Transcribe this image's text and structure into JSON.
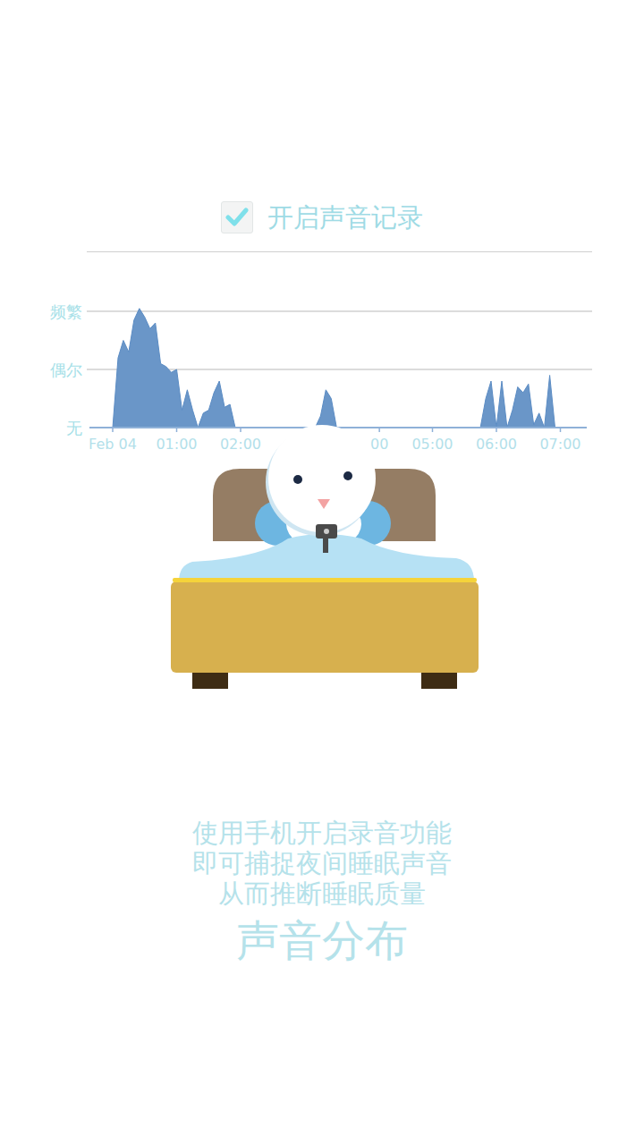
{
  "checkbox": {
    "label": "开启声音记录",
    "checked": true
  },
  "chart": {
    "y_ticks": [
      {
        "label": "频繁",
        "value": 2
      },
      {
        "label": "偶尔",
        "value": 1
      },
      {
        "label": "无",
        "value": 0
      }
    ],
    "x_ticks": [
      {
        "label": "Feb 04",
        "hour": 0
      },
      {
        "label": "01:00",
        "hour": 1
      },
      {
        "label": "02:00",
        "hour": 2
      },
      {
        "label": "00",
        "hour": 4.17
      },
      {
        "label": "05:00",
        "hour": 5
      },
      {
        "label": "06:00",
        "hour": 6
      },
      {
        "label": "07:00",
        "hour": 7
      }
    ],
    "series": [
      {
        "values": [
          0,
          1.2,
          1.5,
          1.3,
          1.85,
          2.05,
          1.9,
          1.7,
          1.8,
          1.1,
          1.05,
          0.95,
          1.0,
          0.3,
          0.65,
          0.3,
          0,
          0.25,
          0.3,
          0.6,
          0.8,
          0.35,
          0.4,
          0,
          0,
          0,
          0,
          0,
          0,
          0,
          0,
          0,
          0,
          0,
          0,
          0,
          0,
          0,
          0,
          0.2,
          0.65,
          0.5,
          0,
          0,
          0,
          0,
          0,
          0,
          0,
          0,
          0,
          0,
          0,
          0,
          0,
          0,
          0,
          0,
          0,
          0,
          0,
          0,
          0,
          0,
          0,
          0,
          0,
          0,
          0,
          0,
          0.5,
          0.8,
          0,
          0.8,
          0,
          0.3,
          0.7,
          0.6,
          0.75,
          0.05,
          0.25,
          0,
          0.9,
          0
        ]
      }
    ]
  },
  "caption": {
    "lines": [
      "使用手机开启录音功能",
      "即可捕捉夜间睡眠声音",
      "从而推断睡眠质量"
    ],
    "title": "声音分布"
  }
}
